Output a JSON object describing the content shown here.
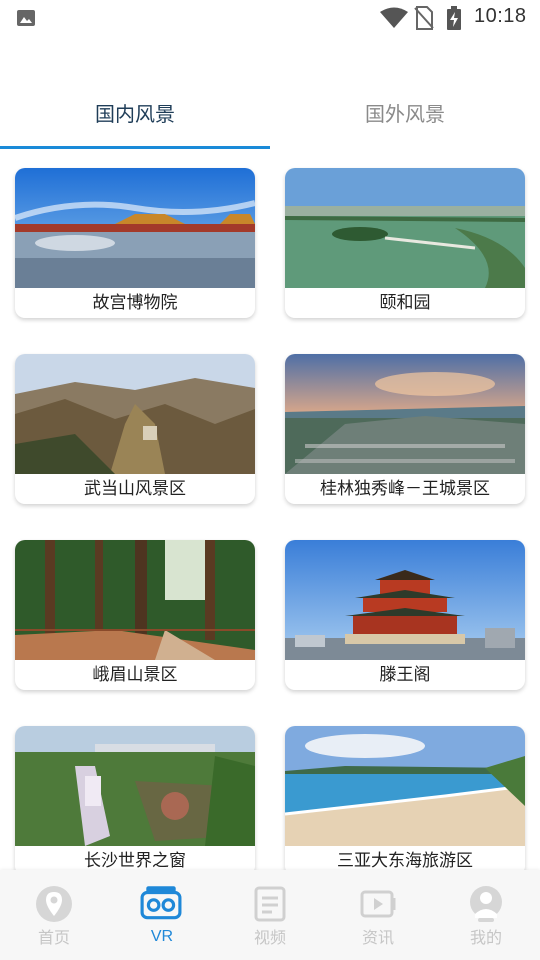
{
  "status_bar": {
    "time": "10:18"
  },
  "tabs": {
    "domestic": "国内风景",
    "foreign": "国外风景"
  },
  "spots": [
    {
      "name": "故宫博物院"
    },
    {
      "name": "颐和园"
    },
    {
      "name": "武当山风景区"
    },
    {
      "name": "桂林独秀峰－王城景区"
    },
    {
      "name": "峨眉山景区"
    },
    {
      "name": "滕王阁"
    },
    {
      "name": "长沙世界之窗"
    },
    {
      "name": "三亚大东海旅游区"
    }
  ],
  "bottom_nav": {
    "home": "首页",
    "vr": "VR",
    "video": "视频",
    "news": "资讯",
    "mine": "我的"
  },
  "colors": {
    "accent": "#1a8ad8",
    "tab_active_text": "#1f3d58",
    "nav_inactive": "#c6c6c6"
  }
}
